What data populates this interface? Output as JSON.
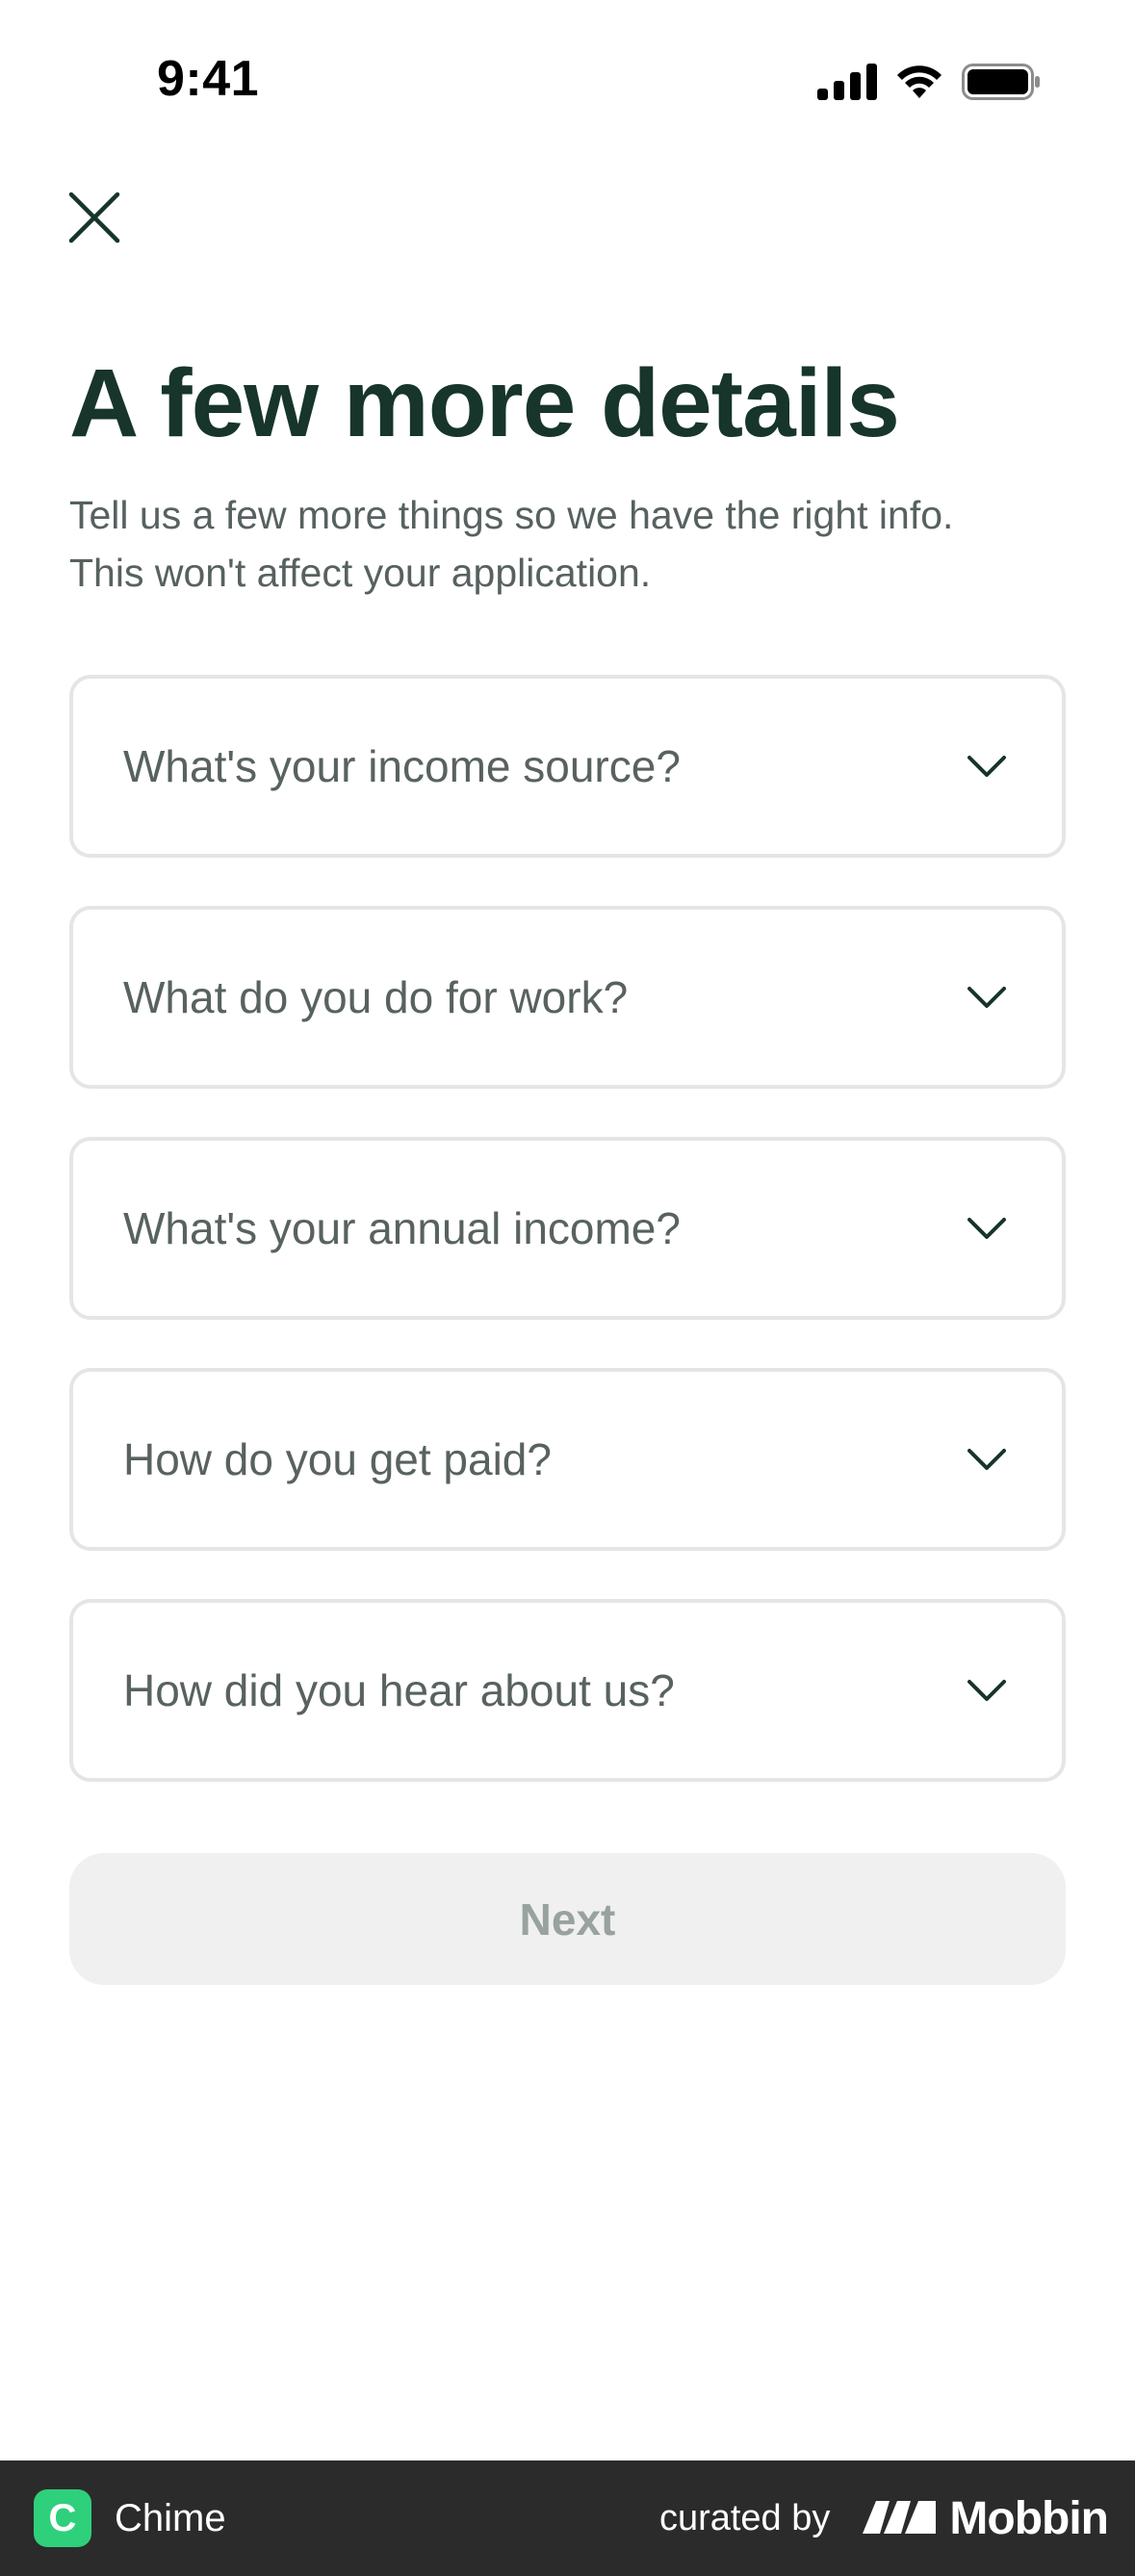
{
  "status_bar": {
    "time": "9:41"
  },
  "header": {
    "close_icon": "close-icon"
  },
  "main": {
    "title": "A few more details",
    "subtitle_line1": "Tell us a few more things so we have the right info.",
    "subtitle_line2": "This won't affect your application.",
    "fields": [
      {
        "label": "What's your income source?"
      },
      {
        "label": "What do you do for work?"
      },
      {
        "label": "What's your annual income?"
      },
      {
        "label": "How do you get paid?"
      },
      {
        "label": "How did you hear about us?"
      }
    ],
    "next_label": "Next"
  },
  "footer": {
    "app_logo_letter": "C",
    "app_name": "Chime",
    "curated_by": "curated by",
    "brand": "Mobbin"
  },
  "colors": {
    "title": "#17352a",
    "subtitle": "#566160",
    "field_border": "#e4e6e5",
    "next_bg": "#f0f0f0",
    "next_text": "#98a29f",
    "footer_bg": "#2b2b2b",
    "chime_green": "#2fd07b"
  }
}
